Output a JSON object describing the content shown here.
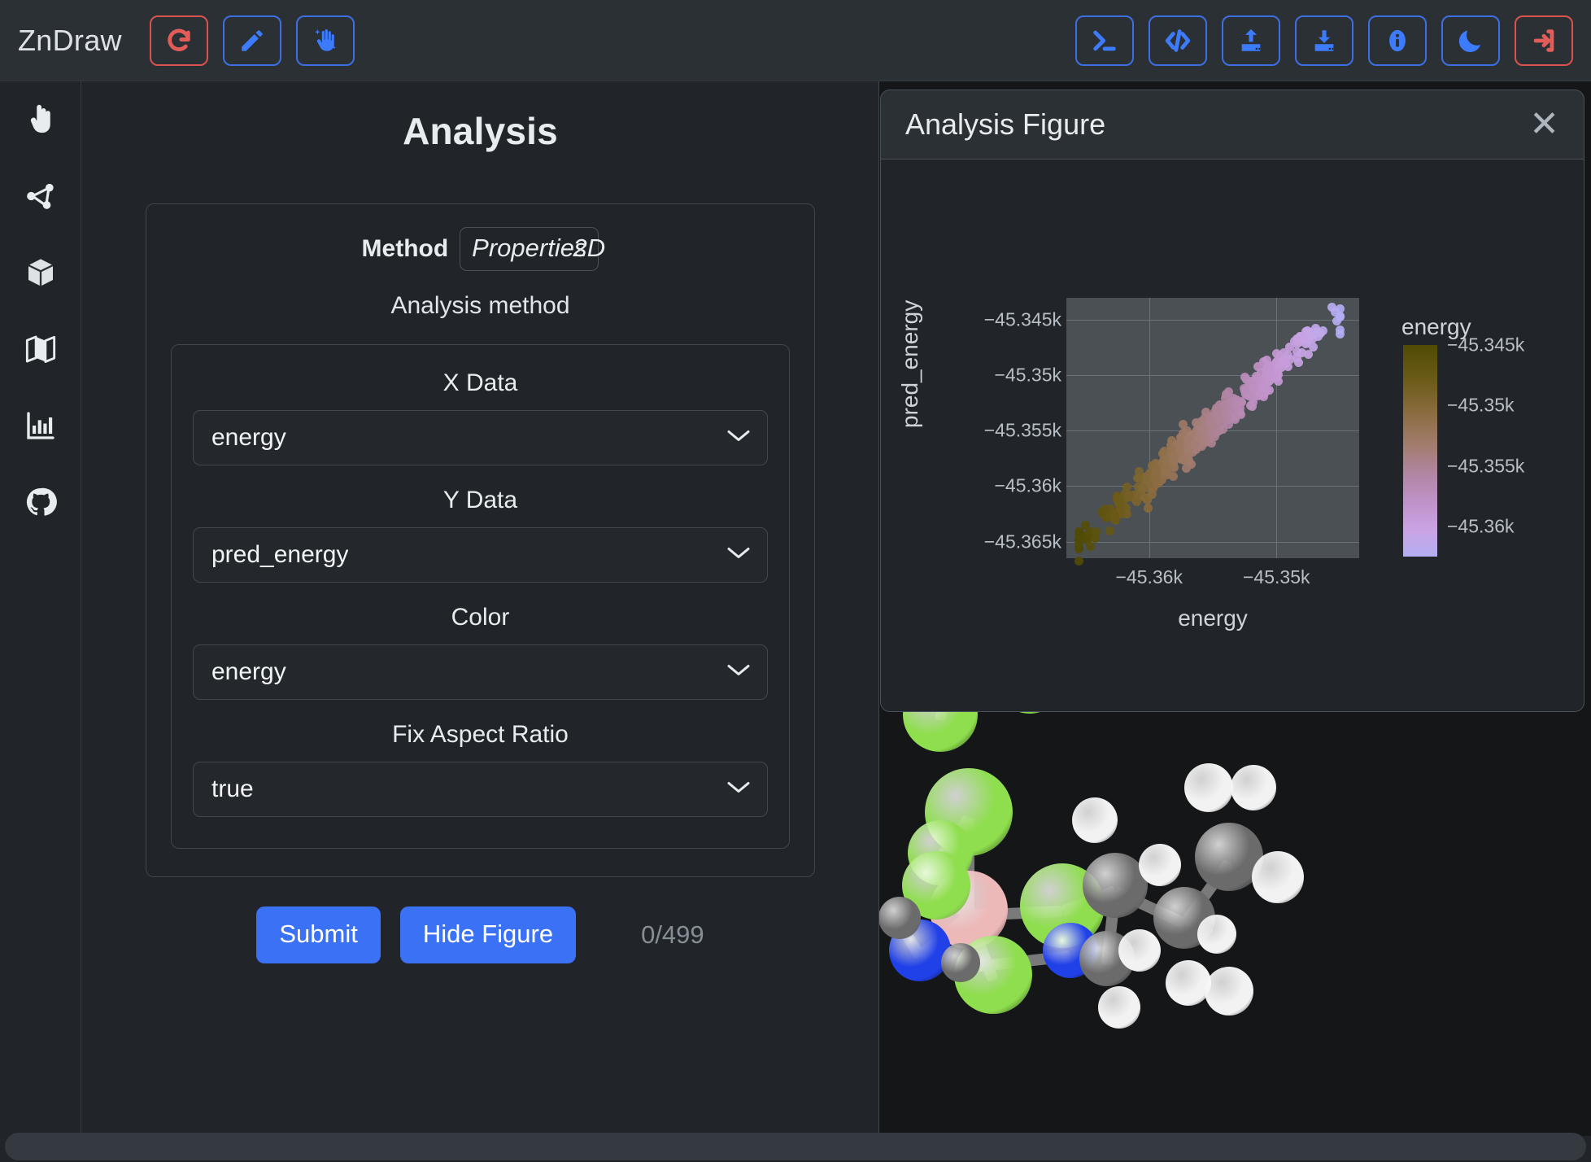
{
  "app": {
    "brand": "ZnDraw",
    "background": "#212529",
    "accent": "#3b71f5",
    "danger": "#d9534f"
  },
  "navbar": {
    "left_buttons": [
      {
        "name": "reset-button",
        "icon": "rotate-right-icon",
        "color": "#e25c58"
      },
      {
        "name": "draw-button",
        "icon": "pencil-icon",
        "color": "#3d7bfd"
      },
      {
        "name": "interact-button",
        "icon": "hand-sparkle-icon",
        "color": "#3d7bfd"
      }
    ],
    "right_buttons": [
      {
        "name": "console-button",
        "icon": "terminal-icon",
        "color": "#3d7bfd"
      },
      {
        "name": "code-button",
        "icon": "code-icon",
        "color": "#3d7bfd"
      },
      {
        "name": "upload-button",
        "icon": "upload-icon",
        "color": "#3d7bfd"
      },
      {
        "name": "download-button",
        "icon": "download-icon",
        "color": "#3d7bfd"
      },
      {
        "name": "info-button",
        "icon": "info-circle-icon",
        "color": "#3d7bfd"
      },
      {
        "name": "theme-button",
        "icon": "moon-icon",
        "color": "#3d7bfd"
      },
      {
        "name": "logout-button",
        "icon": "sign-out-icon",
        "color": "#e25c58"
      }
    ]
  },
  "sidebar": {
    "items": [
      {
        "name": "sidebar-item-select",
        "icon": "hand-pointer-icon"
      },
      {
        "name": "sidebar-item-bonds",
        "icon": "share-nodes-icon"
      },
      {
        "name": "sidebar-item-cell",
        "icon": "cube-icon"
      },
      {
        "name": "sidebar-item-scene",
        "icon": "map-icon"
      },
      {
        "name": "sidebar-item-analysis",
        "icon": "chart-bar-icon"
      },
      {
        "name": "sidebar-item-github",
        "icon": "github-icon"
      }
    ]
  },
  "analysis": {
    "title": "Analysis",
    "method_label": "Method",
    "method_value_base": "Properties",
    "method_value_suffix": "2D",
    "method_value": "Properties2D",
    "subtitle": "Analysis method",
    "fields": [
      {
        "label": "X Data",
        "value": "energy",
        "name": "x-data-select"
      },
      {
        "label": "Y Data",
        "value": "pred_energy",
        "name": "y-data-select"
      },
      {
        "label": "Color",
        "value": "energy",
        "name": "color-select"
      },
      {
        "label": "Fix Aspect Ratio",
        "value": "true",
        "name": "fix-aspect-ratio-select"
      }
    ],
    "submit_label": "Submit",
    "hide_figure_label": "Hide Figure",
    "counter": "0/499"
  },
  "figure": {
    "title": "Analysis Figure",
    "close_label": "✕"
  },
  "chart_data": {
    "type": "scatter",
    "title": "",
    "xlabel": "energy",
    "ylabel": "pred_energy",
    "xticks": [
      "−45.36k",
      "−45.35k"
    ],
    "xtick_values": [
      -45360,
      -45350
    ],
    "yticks": [
      "−45.345k",
      "−45.35k",
      "−45.355k",
      "−45.36k",
      "−45.365k"
    ],
    "ytick_values": [
      -45345,
      -45350,
      -45355,
      -45360,
      -45365
    ],
    "xlim": [
      -45366.5,
      -45343.5
    ],
    "ylim": [
      -45366.5,
      -45343.0
    ],
    "grid": true,
    "colorbar": {
      "title": "energy",
      "ticks": [
        "−45.345k",
        "−45.35k",
        "−45.355k",
        "−45.36k"
      ],
      "tick_values": [
        -45345,
        -45350,
        -45355,
        -45360
      ],
      "colorscale": [
        "#4f4b05",
        "#6b5a18",
        "#8a6c3f",
        "#a37d70",
        "#b286a7",
        "#c294cd",
        "#c9a4e5",
        "#b3aef2"
      ]
    },
    "color_by": "energy",
    "n_points": 499,
    "legend": null,
    "description": "Scatter of pred_energy vs energy, strongly positively correlated along the diagonal, points colored by energy from lavender (low) to olive (high)."
  },
  "viewer": {
    "name": "molecule-3d-viewer",
    "atom_colors": {
      "hydrogen": "#f2f2f2",
      "carbon": "#6b6b6b",
      "nitrogen": "#2040e8",
      "chlorine": "#8ede4d",
      "phosphorus": "#edb8b8"
    }
  },
  "bottom_bar": {
    "name": "status-bar"
  }
}
